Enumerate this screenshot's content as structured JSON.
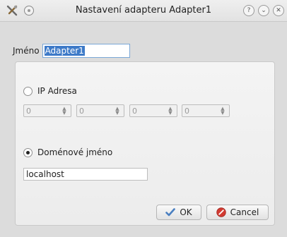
{
  "window": {
    "title": "Nastavení adapteru Adapter1",
    "help_glyph": "?",
    "minimize_glyph": "⌄",
    "close_glyph": "✕"
  },
  "form": {
    "name_label": "Jméno",
    "name_value": "Adapter1",
    "ip": {
      "label": "IP Adresa",
      "checked": false,
      "octets": [
        "0",
        "0",
        "0",
        "0"
      ]
    },
    "domain": {
      "label": "Doménové jméno",
      "checked": true,
      "value": "localhost"
    }
  },
  "buttons": {
    "ok_label": "OK",
    "cancel_label": "Cancel"
  },
  "icons": {
    "app": "tools-icon",
    "ok": "checkmark-icon",
    "cancel": "stop-icon"
  },
  "colors": {
    "selection": "#3d7ac8",
    "ok_check": "#4a7fc0",
    "cancel_red": "#d23b32"
  }
}
